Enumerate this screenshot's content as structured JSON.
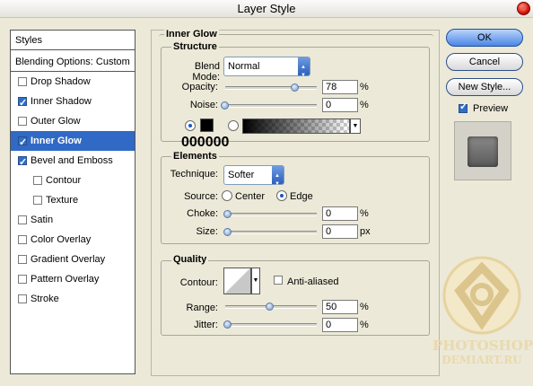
{
  "window": {
    "title": "Layer Style"
  },
  "styles_list": {
    "header": "Styles",
    "blending": "Blending Options: Custom",
    "items": [
      {
        "label": "Drop Shadow",
        "checked": false
      },
      {
        "label": "Inner Shadow",
        "checked": true
      },
      {
        "label": "Outer Glow",
        "checked": false
      },
      {
        "label": "Inner Glow",
        "checked": true,
        "selected": true
      },
      {
        "label": "Bevel and Emboss",
        "checked": true
      },
      {
        "label": "Contour",
        "checked": false,
        "indent": true
      },
      {
        "label": "Texture",
        "checked": false,
        "indent": true
      },
      {
        "label": "Satin",
        "checked": false
      },
      {
        "label": "Color Overlay",
        "checked": false
      },
      {
        "label": "Gradient Overlay",
        "checked": false
      },
      {
        "label": "Pattern Overlay",
        "checked": false
      },
      {
        "label": "Stroke",
        "checked": false
      }
    ]
  },
  "panel": {
    "title": "Inner Glow",
    "structure": {
      "title": "Structure",
      "blend_mode_label": "Blend Mode:",
      "blend_mode": "Normal",
      "opacity_label": "Opacity:",
      "opacity": "78",
      "opacity_slider": 0.78,
      "noise_label": "Noise:",
      "noise": "0",
      "noise_slider": 0,
      "unit": "%",
      "color_hex": "000000"
    },
    "elements": {
      "title": "Elements",
      "technique_label": "Technique:",
      "technique": "Softer",
      "source_label": "Source:",
      "source_center": "Center",
      "source_edge": "Edge",
      "choke_label": "Choke:",
      "choke": "0",
      "choke_unit": "%",
      "size_label": "Size:",
      "size": "0",
      "size_unit": "px"
    },
    "quality": {
      "title": "Quality",
      "contour_label": "Contour:",
      "antialiased_label": "Anti-aliased",
      "range_label": "Range:",
      "range": "50",
      "range_slider": 0.5,
      "range_unit": "%",
      "jitter_label": "Jitter:",
      "jitter": "0",
      "jitter_unit": "%"
    }
  },
  "buttons": {
    "ok": "OK",
    "cancel": "Cancel",
    "new_style": "New Style...",
    "preview": "Preview"
  },
  "watermark": {
    "line1": "PHOTOSHOP",
    "line2": "DEMIART.RU"
  },
  "colors": {
    "selection": "#3169c6",
    "swatch": "#000000",
    "accent": "#4b86e6"
  }
}
